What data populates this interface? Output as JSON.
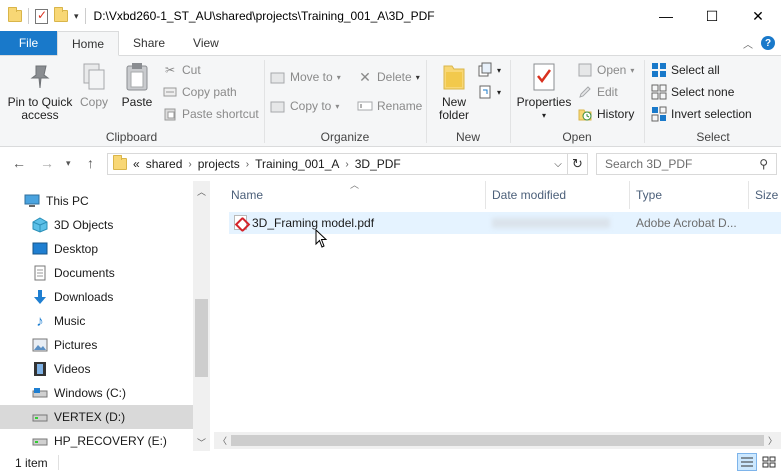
{
  "window": {
    "title_path": "D:\\Vxbd260-1_ST_AU\\shared\\projects\\Training_001_A\\3D_PDF",
    "minimize": "—",
    "maximize": "☐",
    "close": "✕"
  },
  "ribbon_tabs": [
    "File",
    "Home",
    "Share",
    "View"
  ],
  "ribbon": {
    "clipboard": {
      "label": "Clipboard",
      "pin": "Pin to Quick access",
      "copy": "Copy",
      "paste": "Paste",
      "cut": "Cut",
      "copy_path": "Copy path",
      "paste_shortcut": "Paste shortcut"
    },
    "organize": {
      "label": "Organize",
      "move_to": "Move to",
      "copy_to": "Copy to",
      "delete": "Delete",
      "rename": "Rename"
    },
    "new": {
      "label": "New",
      "new_folder": "New folder"
    },
    "open": {
      "label": "Open",
      "properties": "Properties",
      "open": "Open",
      "edit": "Edit",
      "history": "History"
    },
    "select": {
      "label": "Select",
      "select_all": "Select all",
      "select_none": "Select none",
      "invert_selection": "Invert selection"
    }
  },
  "address": {
    "overflow": "«",
    "crumbs": [
      "shared",
      "projects",
      "Training_001_A",
      "3D_PDF"
    ]
  },
  "search": {
    "placeholder": "Search 3D_PDF"
  },
  "nav_pane": {
    "items": [
      {
        "label": "This PC",
        "icon": "computer-icon"
      },
      {
        "label": "3D Objects",
        "icon": "3d-objects-icon"
      },
      {
        "label": "Desktop",
        "icon": "desktop-icon"
      },
      {
        "label": "Documents",
        "icon": "documents-icon"
      },
      {
        "label": "Downloads",
        "icon": "downloads-icon"
      },
      {
        "label": "Music",
        "icon": "music-icon"
      },
      {
        "label": "Pictures",
        "icon": "pictures-icon"
      },
      {
        "label": "Videos",
        "icon": "videos-icon"
      },
      {
        "label": "Windows (C:)",
        "icon": "drive-icon"
      },
      {
        "label": "VERTEX (D:)",
        "icon": "drive-icon"
      },
      {
        "label": "HP_RECOVERY (E:)",
        "icon": "drive-icon"
      }
    ],
    "selected_index": 9
  },
  "file_list": {
    "columns": [
      "Name",
      "Date modified",
      "Type",
      "Size"
    ],
    "files": [
      {
        "name": "3D_Framing model.pdf",
        "type": "Adobe Acrobat D...",
        "icon": "pdf-icon"
      }
    ]
  },
  "status": {
    "item_count": "1 item"
  },
  "colors": {
    "file_tab": "#1979ca",
    "ribbon_bg": "#f5f6f7",
    "row_hover": "#e5f3ff",
    "selected_nav": "#d9d9d9"
  }
}
